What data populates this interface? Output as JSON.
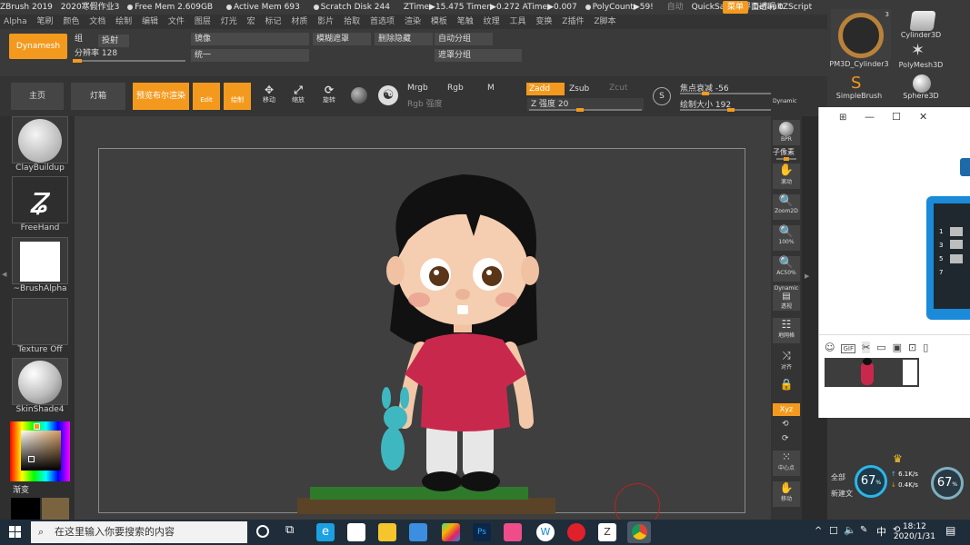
{
  "title_bar": {
    "app": "ZBrush 2019",
    "doc": "2020寒假作业3",
    "free_mem": "Free Mem 2.609GB",
    "active_mem": "Active Mem 693",
    "scratch": "Scratch Disk 244",
    "ztime": "ZTime▶15.475 Timer▶0.272 ATime▶0.007",
    "polycount": "PolyCount▶59!",
    "auto": "自动",
    "quicksave": "QuickSave",
    "transparency": "界面透明 0",
    "menu": "菜单",
    "script": "DefaultZScript"
  },
  "menu_items": [
    "Alpha",
    "笔刷",
    "颜色",
    "文档",
    "绘制",
    "编辑",
    "文件",
    "图层",
    "灯光",
    "宏",
    "标记",
    "材质",
    "影片",
    "拾取",
    "首选项",
    "渲染",
    "模板",
    "笔触",
    "纹理",
    "工具",
    "变换",
    "Z插件",
    "Z脚本"
  ],
  "top_palette": {
    "dynamesh": "Dynamesh",
    "group": "组",
    "project": "投射",
    "resolution": "分辨率 128",
    "mirror": "镜像",
    "unify": "统一",
    "blur_mask": "模糊遮罩",
    "delete_hidden": "删除隐藏",
    "auto_group": "自动分组",
    "mask_group": "遮罩分组"
  },
  "shelf": {
    "home": "主页",
    "lightbox": "灯箱",
    "bpr": "预览布尔渲染",
    "edit": "Edit",
    "draw": "绘制",
    "move": "移动",
    "scale": "缩放",
    "rotate": "旋转",
    "mrgb": "Mrgb",
    "rgb": "Rgb",
    "m": "M",
    "zadd": "Zadd",
    "zsub": "Zsub",
    "zcut": "Zcut",
    "rgb_intensity": "Rgb 强度",
    "z_intensity": "Z 强度 20",
    "focal": "焦点衰减 -56",
    "draw_size": "绘制大小 192",
    "dynamic": "Dynamic"
  },
  "left_tray": {
    "brush1": "ClayBuildup",
    "brush2": "FreeHand",
    "brush3": "~BrushAlpha",
    "texture": "Texture Off",
    "material": "SkinShade4",
    "gradient": "渐变"
  },
  "right_shelf": {
    "bpr": "BPR",
    "subtool": "子像素",
    "scroll": "滚动",
    "zoom2d": "Zoom2D",
    "zoom100": "100%",
    "ac50": "AC50%",
    "dynamic": "Dynamic",
    "perspective": "透视",
    "floor": "地网格",
    "frame": "对齐",
    "xyz": "Xyz",
    "center": "中心点",
    "move": "移动"
  },
  "right_panel": {
    "tool1": "PM3D_Cylinder3",
    "tool2": "Cylinder3D",
    "tool3": "PolyMesh3D",
    "tool4": "SimpleBrush",
    "tool5": "Sphere3D",
    "count": "3",
    "all": "全部",
    "new": "新建文",
    "net_up": "6.1K/s",
    "net_down": "0.4K/s",
    "cpu1": "67",
    "cpu2": "67"
  },
  "chat_window": {
    "rows": [
      "1",
      "3",
      "5",
      "7"
    ]
  },
  "taskbar": {
    "search_placeholder": "在这里输入你要搜索的内容",
    "ime": "中",
    "time": "18:12",
    "date": "2020/1/31"
  }
}
